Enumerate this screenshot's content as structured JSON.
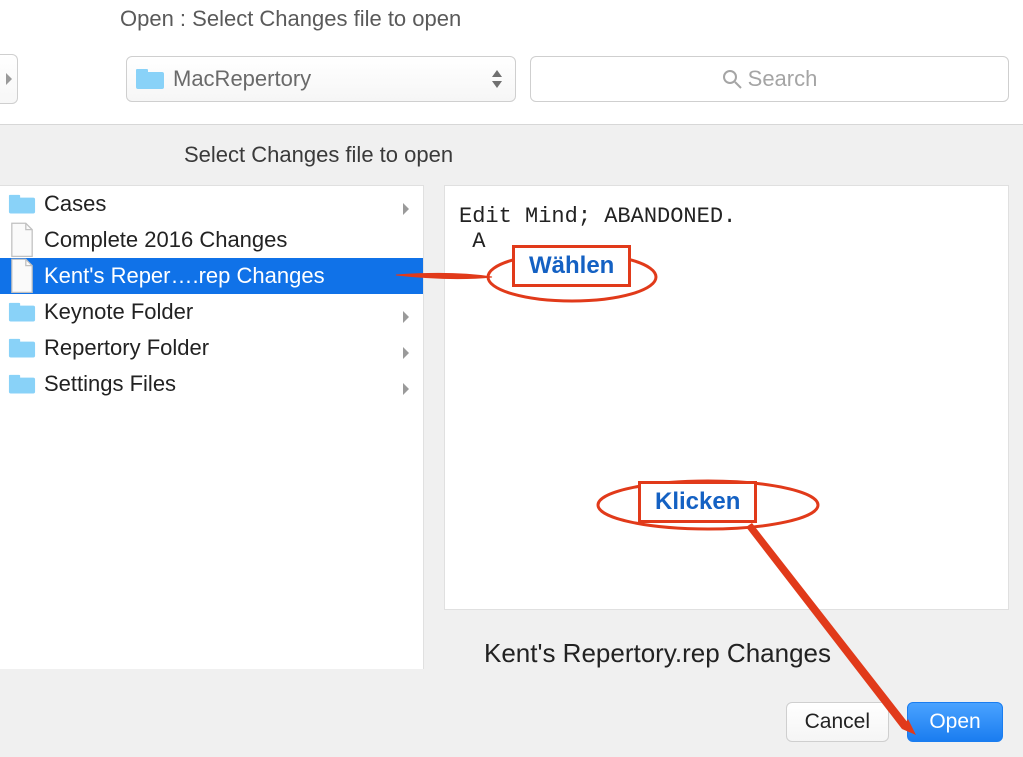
{
  "dialog_title": "Open : Select Changes file to open",
  "folder_selector": {
    "current_folder": "MacRepertory"
  },
  "search": {
    "placeholder": "Search"
  },
  "subtitle": "Select Changes file to open",
  "file_list": [
    {
      "name": "Cases",
      "kind": "folder",
      "has_children": true,
      "selected": false
    },
    {
      "name": "Complete 2016 Changes",
      "kind": "file",
      "has_children": false,
      "selected": false
    },
    {
      "name": "Kent's Reper….rep Changes",
      "kind": "file",
      "has_children": false,
      "selected": true
    },
    {
      "name": "Keynote Folder",
      "kind": "folder",
      "has_children": true,
      "selected": false
    },
    {
      "name": "Repertory Folder",
      "kind": "folder",
      "has_children": true,
      "selected": false
    },
    {
      "name": "Settings Files",
      "kind": "folder",
      "has_children": true,
      "selected": false
    }
  ],
  "preview_text": "Edit Mind; ABANDONED.\n A",
  "preview_filename": "Kent's Repertory.rep Changes",
  "buttons": {
    "cancel": "Cancel",
    "open": "Open"
  },
  "annotations": {
    "choose_label": "Wählen",
    "click_label": "Klicken"
  }
}
